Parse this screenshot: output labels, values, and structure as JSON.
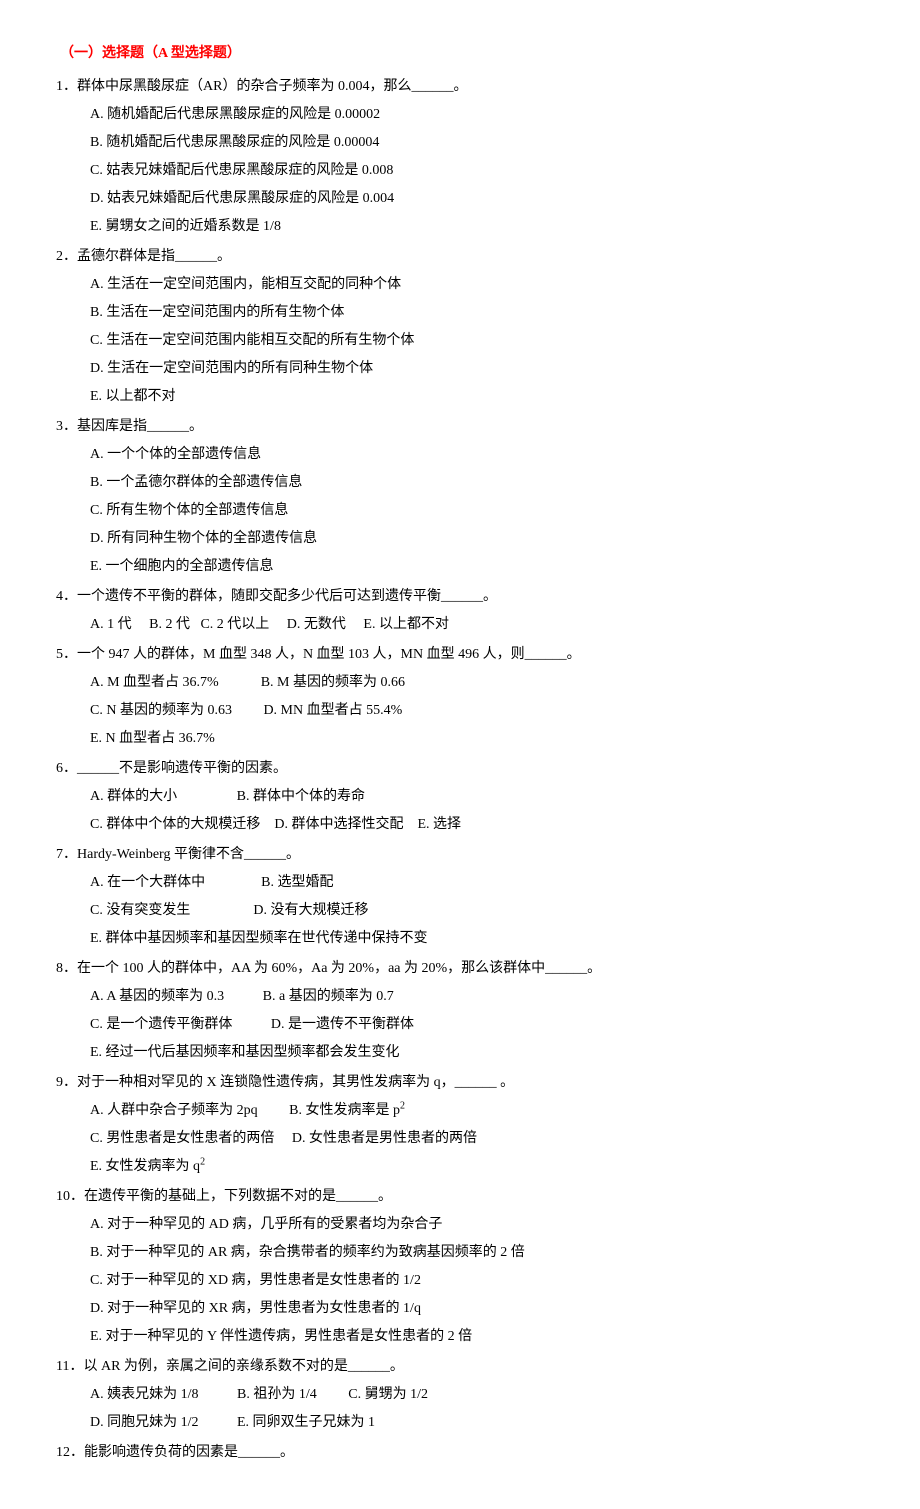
{
  "title": "（一）选择题（A 型选择题）",
  "questions": [
    {
      "num": "1．",
      "stem": "群体中尿黑酸尿症（AR）的杂合子频率为 0.004，那么______。",
      "display": "block",
      "options": [
        "A. 随机婚配后代患尿黑酸尿症的风险是 0.00002",
        "B. 随机婚配后代患尿黑酸尿症的风险是 0.00004",
        "C. 姑表兄妹婚配后代患尿黑酸尿症的风险是 0.008",
        "D. 姑表兄妹婚配后代患尿黑酸尿症的风险是 0.004",
        "E. 舅甥女之间的近婚系数是 1/8"
      ]
    },
    {
      "num": "2．",
      "stem": "孟德尔群体是指______。",
      "display": "block",
      "options": [
        "A. 生活在一定空间范围内，能相互交配的同种个体",
        "B. 生活在一定空间范围内的所有生物个体",
        "C. 生活在一定空间范围内能相互交配的所有生物个体",
        "D. 生活在一定空间范围内的所有同种生物个体",
        "E. 以上都不对"
      ]
    },
    {
      "num": "3．",
      "stem": "基因库是指______。",
      "display": "block",
      "options": [
        "A. 一个个体的全部遗传信息",
        "B. 一个孟德尔群体的全部遗传信息",
        "C. 所有生物个体的全部遗传信息",
        "D. 所有同种生物个体的全部遗传信息",
        "E. 一个细胞内的全部遗传信息"
      ]
    },
    {
      "num": "4．",
      "stem": "一个遗传不平衡的群体，随即交配多少代后可达到遗传平衡______。",
      "display": "inline",
      "inline": "A. 1 代     B. 2 代   C. 2 代以上     D. 无数代     E. 以上都不对"
    },
    {
      "num": "5．",
      "stem": "一个 947 人的群体，M 血型 348 人，N 血型 103 人，MN 血型 496 人，则______。",
      "display": "rows",
      "rows": [
        "A. M 血型者占 36.7%            B. M 基因的频率为 0.66",
        "C. N 基因的频率为 0.63         D. MN 血型者占 55.4%",
        "E. N 血型者占 36.7%"
      ]
    },
    {
      "num": "6．",
      "stem": "______不是影响遗传平衡的因素。",
      "display": "rows",
      "rows": [
        "A. 群体的大小                 B. 群体中个体的寿命",
        "C. 群体中个体的大规模迁移    D. 群体中选择性交配    E. 选择"
      ]
    },
    {
      "num": "7．",
      "stem": "Hardy-Weinberg 平衡律不含______。",
      "display": "rows",
      "rows": [
        "A. 在一个大群体中                B. 选型婚配",
        "C. 没有突变发生                  D. 没有大规模迁移",
        "E. 群体中基因频率和基因型频率在世代传递中保持不变"
      ]
    },
    {
      "num": "8．",
      "stem": "在一个 100 人的群体中，AA 为 60%，Aa 为 20%，aa 为 20%，那么该群体中______。",
      "display": "rows",
      "rows": [
        "A. A 基因的频率为 0.3           B. a 基因的频率为 0.7",
        "C. 是一个遗传平衡群体           D. 是一遗传不平衡群体",
        "E. 经过一代后基因频率和基因型频率都会发生变化"
      ]
    },
    {
      "num": "9．",
      "stem": "对于一种相对罕见的 X 连锁隐性遗传病，其男性发病率为 q，______ 。",
      "display": "rows_html",
      "rows_html": [
        "A. 人群中杂合子频率为 2pq         B. 女性发病率是 p<sup>2</sup>",
        "C. 男性患者是女性患者的两倍     D. 女性患者是男性患者的两倍",
        "E. 女性发病率为 q<sup>2</sup>"
      ]
    },
    {
      "num": "10．",
      "stem": "在遗传平衡的基础上，下列数据不对的是______。",
      "display": "block",
      "options": [
        "A. 对于一种罕见的 AD 病，几乎所有的受累者均为杂合子",
        "B. 对于一种罕见的 AR 病，杂合携带者的频率约为致病基因频率的 2 倍",
        "C. 对于一种罕见的 XD 病，男性患者是女性患者的 1/2",
        "D. 对于一种罕见的 XR 病，男性患者为女性患者的 1/q",
        "E. 对于一种罕见的 Y 伴性遗传病，男性患者是女性患者的 2 倍"
      ]
    },
    {
      "num": "11．",
      "stem": "以 AR 为例，亲属之间的亲缘系数不对的是______。",
      "display": "rows",
      "rows": [
        "A. 姨表兄妹为 1/8           B. 祖孙为 1/4         C. 舅甥为 1/2",
        "D. 同胞兄妹为 1/2           E. 同卵双生子兄妹为 1"
      ]
    },
    {
      "num": "12．",
      "stem": "能影响遗传负荷的因素是______。",
      "display": "none"
    }
  ]
}
